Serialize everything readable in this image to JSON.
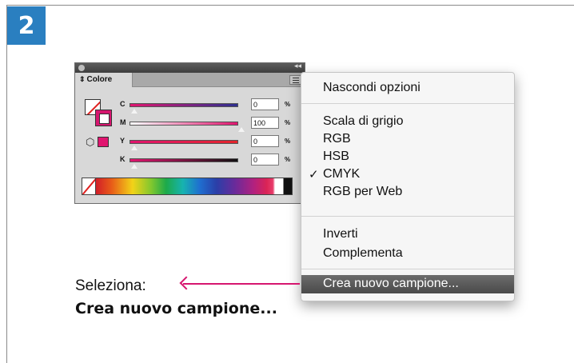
{
  "step": {
    "number": "2",
    "color": "#2a7fc0"
  },
  "panel": {
    "tab_label": "Colore",
    "sliders": [
      {
        "letter": "C",
        "value": "0",
        "unit": "%",
        "level": 0
      },
      {
        "letter": "M",
        "value": "100",
        "unit": "%",
        "level": 1
      },
      {
        "letter": "Y",
        "value": "0",
        "unit": "%",
        "level": 0
      },
      {
        "letter": "K",
        "value": "0",
        "unit": "%",
        "level": 0
      }
    ],
    "accent_color": "#d6166f"
  },
  "menu": {
    "items": [
      {
        "label": "Nascondi opzioni",
        "checked": false
      },
      {
        "label": "Scala di grigio",
        "checked": false
      },
      {
        "label": "RGB",
        "checked": false
      },
      {
        "label": "HSB",
        "checked": false
      },
      {
        "label": "CMYK",
        "checked": true
      },
      {
        "label": "RGB per Web",
        "checked": false
      },
      {
        "label": "Inverti",
        "checked": false
      },
      {
        "label": "Complementa",
        "checked": false
      },
      {
        "label": "Crea nuovo campione...",
        "checked": false,
        "highlighted": true
      }
    ],
    "check_glyph": "✓"
  },
  "callout": {
    "line1": "Seleziona:",
    "line2": "Crea nuovo campione...",
    "arrow_color": "#d6166f"
  }
}
